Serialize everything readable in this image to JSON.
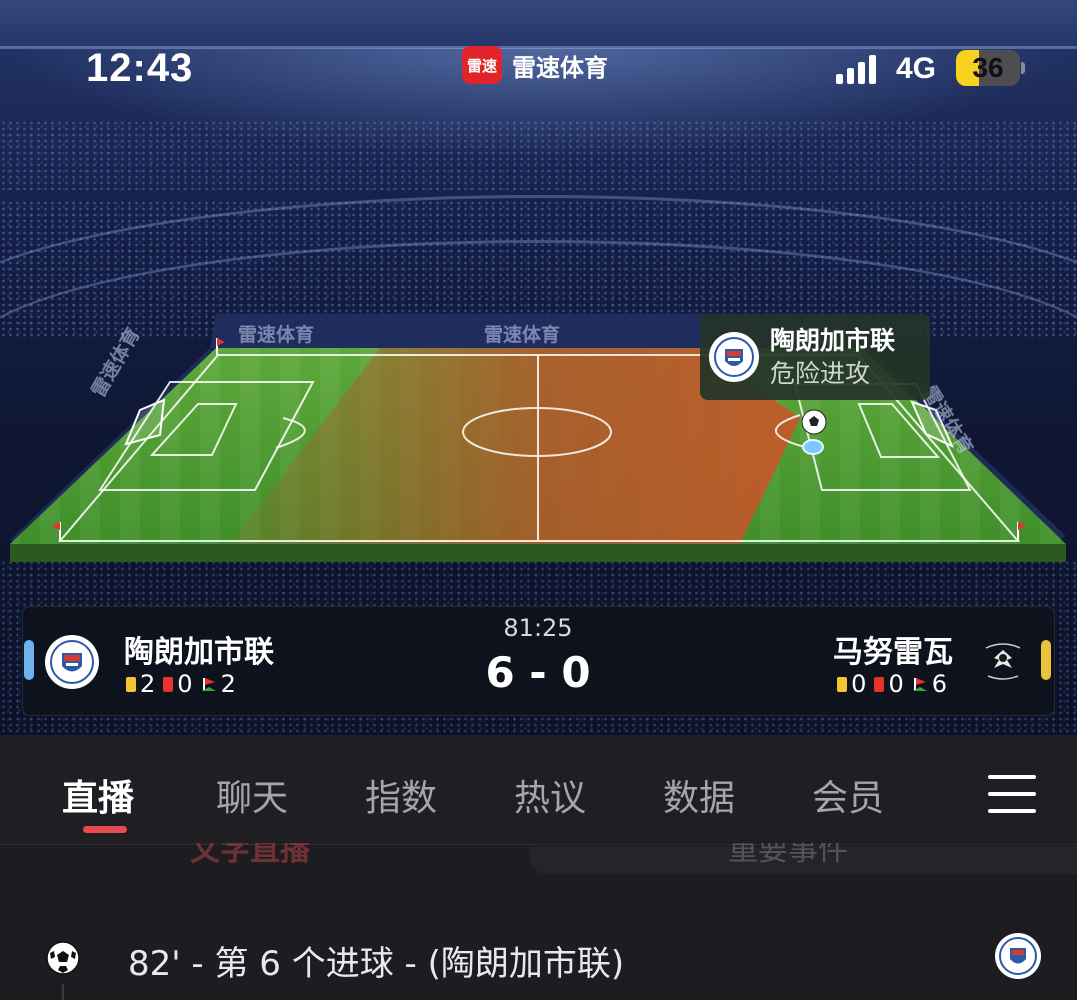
{
  "status_bar": {
    "time": "12:43",
    "network": "4G",
    "battery": "36",
    "battery_fill_fraction": 0.36
  },
  "header": {
    "app_logo_text": "雷速",
    "app_name": "雷速体育"
  },
  "pitch": {
    "board_labels": [
      "雷速体育",
      "雷速体育",
      "雷速体育",
      "雷速体育"
    ],
    "attack_team": "陶朗加市联",
    "attack_status": "危险进攻",
    "attack_zone_color": "#b5552a"
  },
  "match": {
    "clock": "81:25",
    "score": "6 - 0",
    "home": {
      "name": "陶朗加市联",
      "yellow": "2",
      "red": "0",
      "corners": "2",
      "color": "#6db3f0"
    },
    "away": {
      "name": "马努雷瓦",
      "yellow": "0",
      "red": "0",
      "corners": "6",
      "color": "#e8c33b"
    }
  },
  "tabs": [
    {
      "label": "直播",
      "active": true
    },
    {
      "label": "聊天"
    },
    {
      "label": "指数"
    },
    {
      "label": "热议"
    },
    {
      "label": "数据"
    },
    {
      "label": "会员"
    }
  ],
  "subtabs": {
    "left": "文字直播",
    "right": "重要事件"
  },
  "events": [
    {
      "text": "82' - 第 6 个进球 - (陶朗加市联)",
      "icon": "soccer-ball-icon"
    }
  ],
  "colors": {
    "accent_red": "#e84a52",
    "brand_red": "#e0252a"
  }
}
